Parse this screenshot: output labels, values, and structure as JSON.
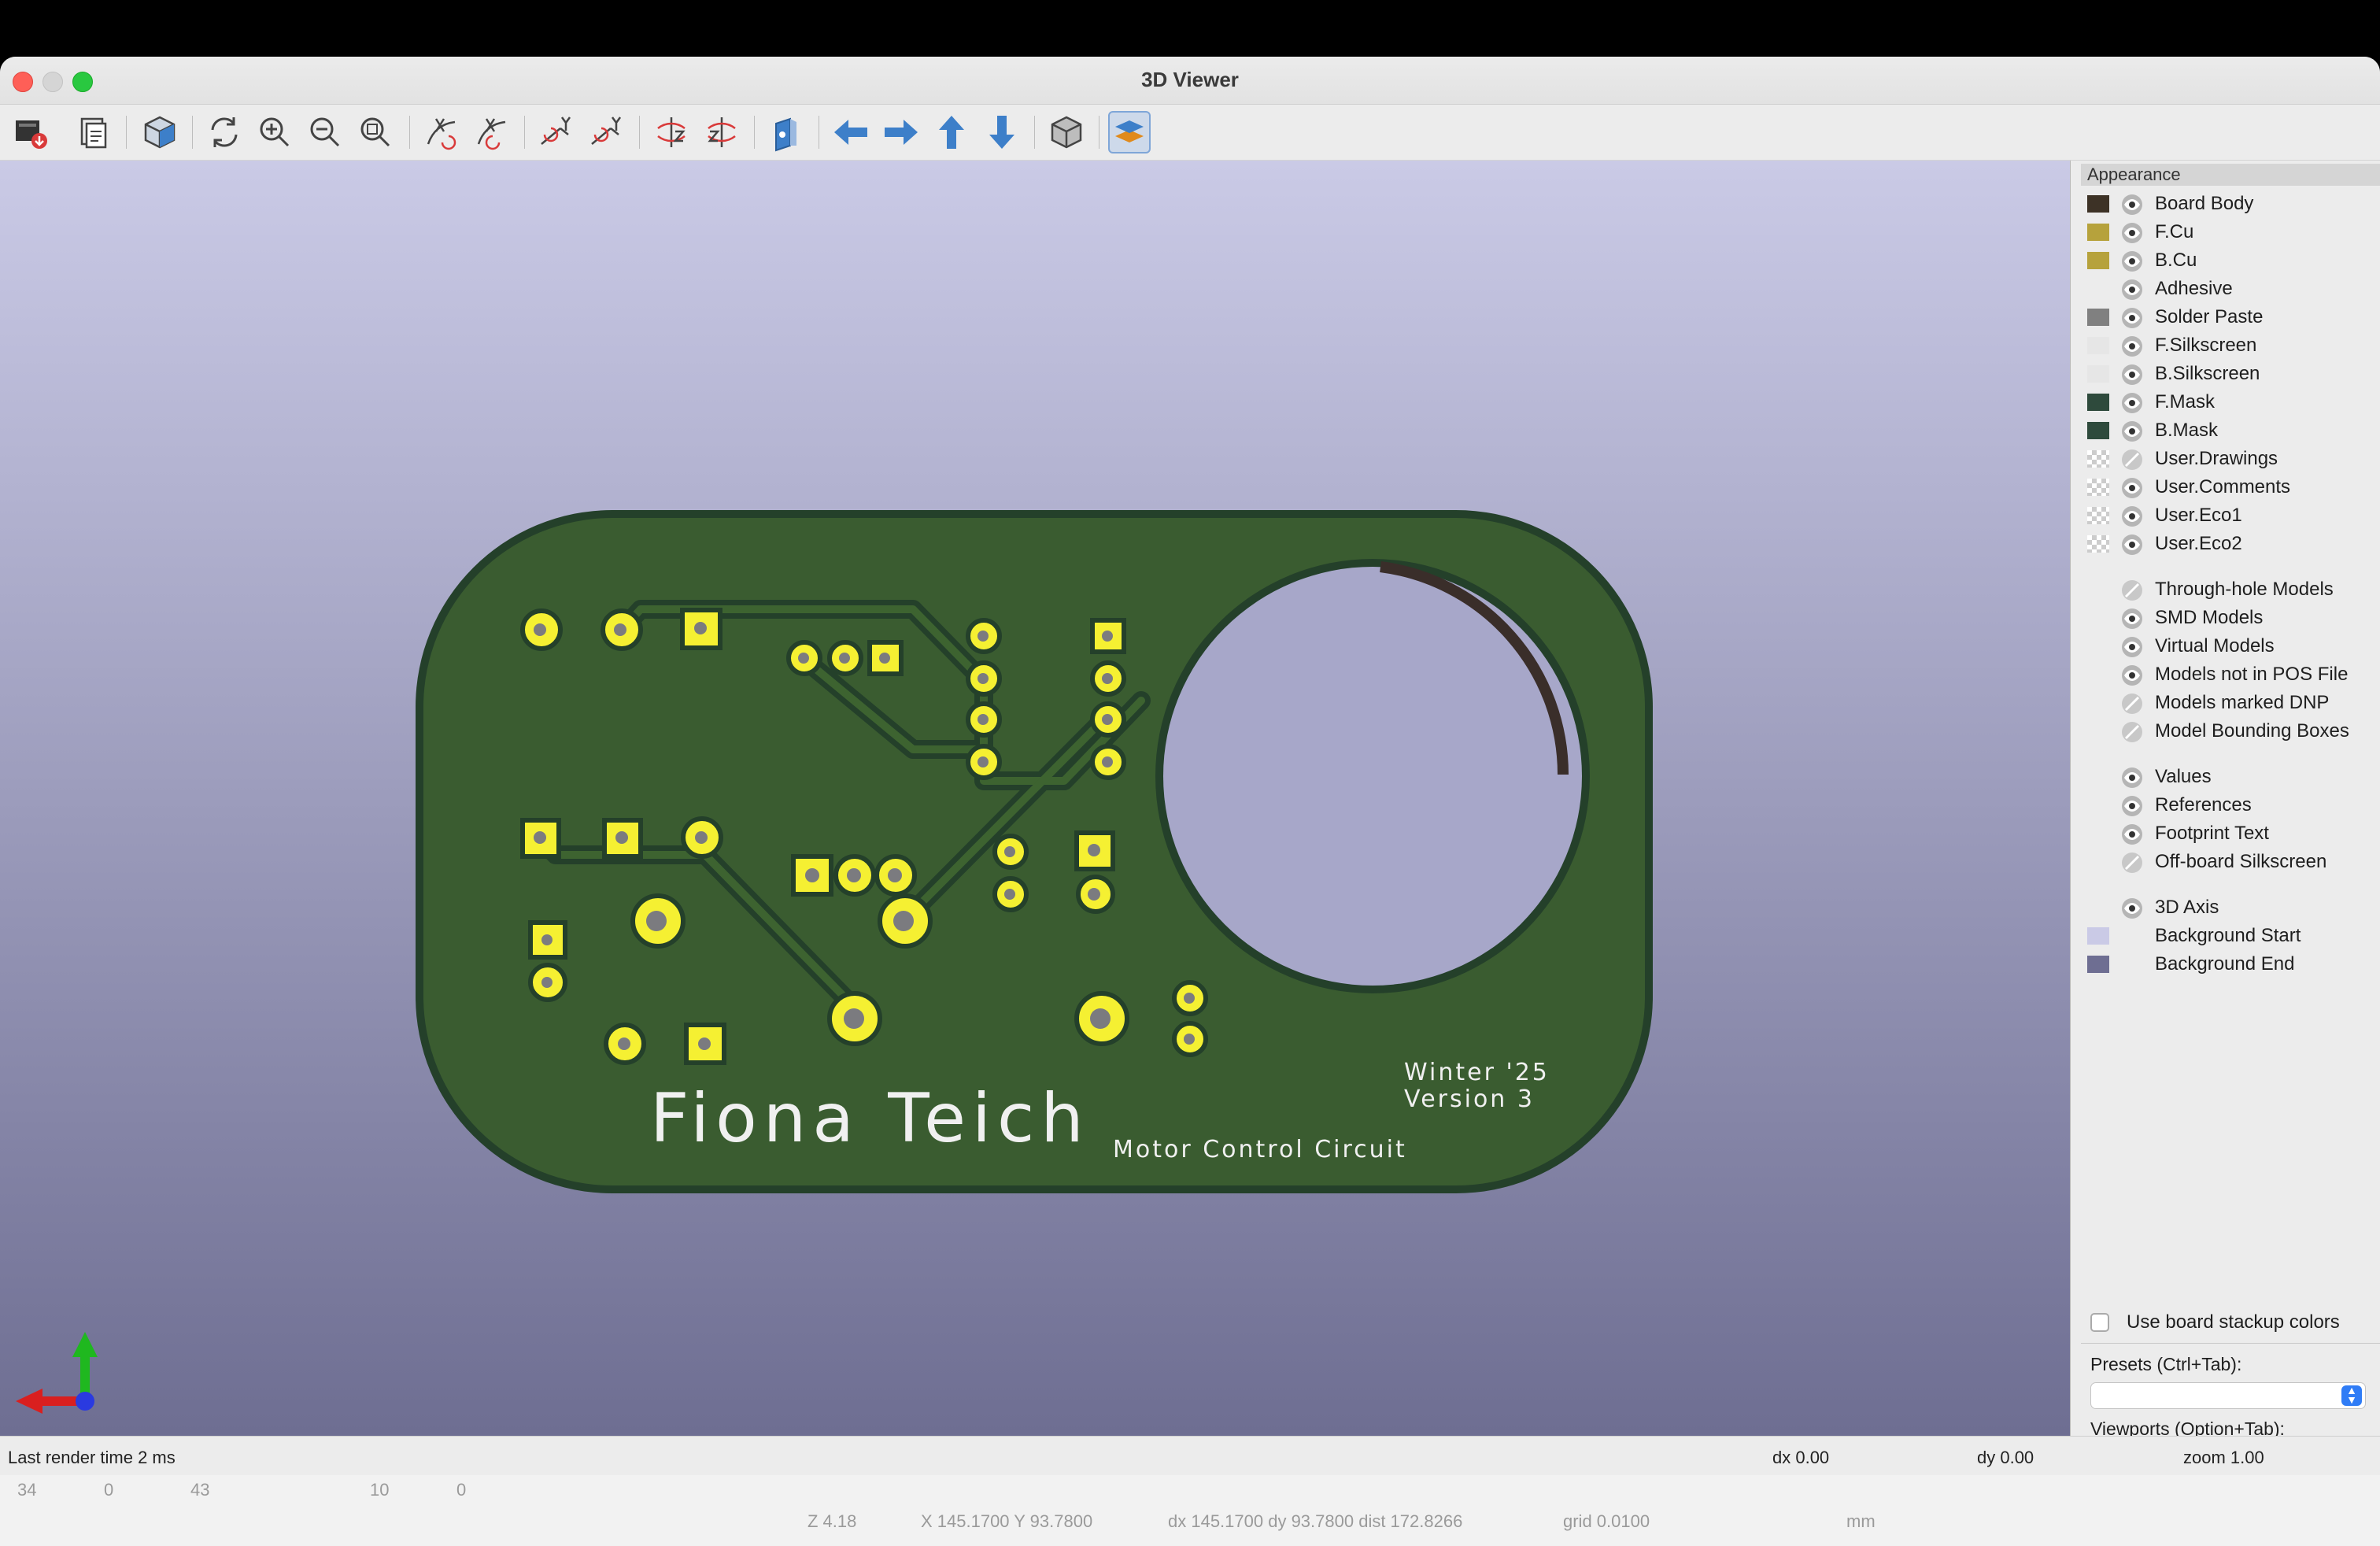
{
  "window": {
    "title": "3D Viewer"
  },
  "toolbar": {
    "buttons": [
      {
        "name": "export-image-icon"
      },
      {
        "name": "copy-clipboard-icon"
      },
      {
        "name": "view-3d-icon"
      },
      {
        "name": "reload-icon"
      },
      {
        "name": "zoom-in-icon"
      },
      {
        "name": "zoom-out-icon"
      },
      {
        "name": "zoom-fit-icon"
      },
      {
        "name": "rotate-x-cw-icon"
      },
      {
        "name": "rotate-x-ccw-icon"
      },
      {
        "name": "rotate-y-cw-icon"
      },
      {
        "name": "rotate-y-ccw-icon"
      },
      {
        "name": "rotate-z-cw-icon"
      },
      {
        "name": "rotate-z-ccw-icon"
      },
      {
        "name": "flip-board-icon"
      },
      {
        "name": "move-left-icon"
      },
      {
        "name": "move-right-icon"
      },
      {
        "name": "move-up-icon"
      },
      {
        "name": "move-down-icon"
      },
      {
        "name": "orthographic-icon"
      },
      {
        "name": "layers-manager-icon"
      }
    ]
  },
  "board": {
    "owner_text": "Fiona Teich",
    "subtitle_text": "Motor Control Circuit",
    "season_text": "Winter '25",
    "version_text": "Version 3",
    "colors": {
      "board": "#3a5c30",
      "mask_edge": "#24402a",
      "copper": "#f5f032",
      "hole": "#7b7b7f"
    }
  },
  "appearance": {
    "header": "Appearance",
    "layers": [
      {
        "label": "Board Body",
        "color": "#3d3226",
        "eye": "visible"
      },
      {
        "label": "F.Cu",
        "color": "#b6a23c",
        "eye": "visible"
      },
      {
        "label": "B.Cu",
        "color": "#b6a23c",
        "eye": "visible"
      },
      {
        "label": "Adhesive",
        "color": "",
        "eye": "visible"
      },
      {
        "label": "Solder Paste",
        "color": "#808080",
        "eye": "visible"
      },
      {
        "label": "F.Silkscreen",
        "color": "#e6e6e6",
        "eye": "visible"
      },
      {
        "label": "B.Silkscreen",
        "color": "#e6e6e6",
        "eye": "visible"
      },
      {
        "label": "F.Mask",
        "color": "#2e4a3c",
        "eye": "visible"
      },
      {
        "label": "B.Mask",
        "color": "#2e4a3c",
        "eye": "visible"
      },
      {
        "label": "User.Drawings",
        "color": "checker",
        "eye": "hidden"
      },
      {
        "label": "User.Comments",
        "color": "checker",
        "eye": "visible"
      },
      {
        "label": "User.Eco1",
        "color": "checker",
        "eye": "visible"
      },
      {
        "label": "User.Eco2",
        "color": "checker",
        "eye": "visible"
      }
    ],
    "models": [
      {
        "label": "Through-hole Models",
        "eye": "hidden"
      },
      {
        "label": "SMD Models",
        "eye": "visible"
      },
      {
        "label": "Virtual Models",
        "eye": "visible"
      },
      {
        "label": "Models not in POS File",
        "eye": "visible"
      },
      {
        "label": "Models marked DNP",
        "eye": "hidden"
      },
      {
        "label": "Model Bounding Boxes",
        "eye": "hidden"
      }
    ],
    "texts": [
      {
        "label": "Values",
        "eye": "visible"
      },
      {
        "label": "References",
        "eye": "visible"
      },
      {
        "label": "Footprint Text",
        "eye": "visible"
      },
      {
        "label": "Off-board Silkscreen",
        "eye": "hidden"
      }
    ],
    "misc": [
      {
        "label": "3D Axis",
        "eye": "visible",
        "color": ""
      },
      {
        "label": "Background Start",
        "eye": "none",
        "color": "#cacae6"
      },
      {
        "label": "Background End",
        "eye": "none",
        "color": "#6e6e92"
      }
    ],
    "use_stackup_label": "Use board stackup colors",
    "presets_label": "Presets (Ctrl+Tab):",
    "viewports_label": "Viewports (Option+Tab):"
  },
  "status": {
    "render_time": "Last render time 2 ms",
    "dx": "dx 0.00",
    "dy": "dy 0.00",
    "zoom": "zoom 1.00"
  },
  "background_window": {
    "row1": [
      "34",
      "0",
      "43",
      "10",
      "0"
    ],
    "z": "Z 4.18",
    "xy": "X 145.1700  Y 93.7800",
    "dxdy": "dx 145.1700  dy 93.7800  dist 172.8266",
    "grid": "grid 0.0100",
    "units": "mm"
  }
}
